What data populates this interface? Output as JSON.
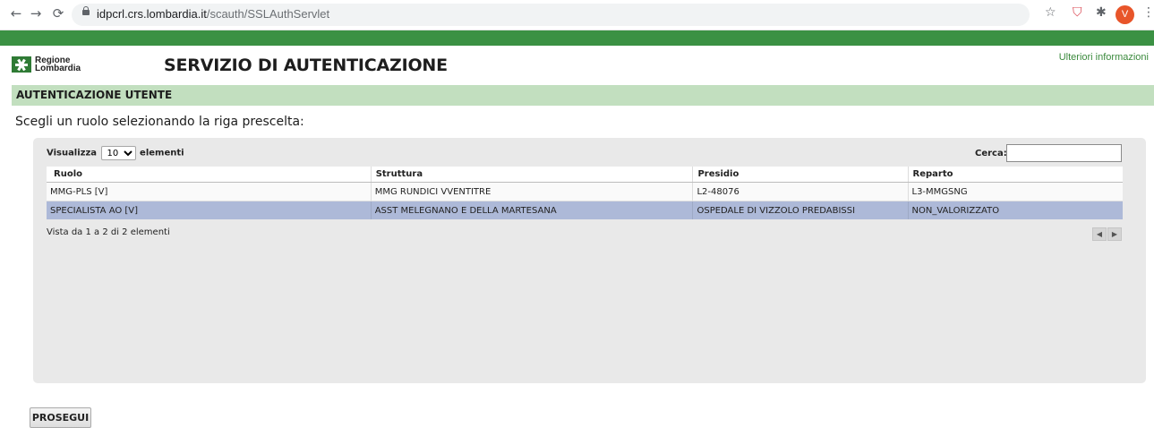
{
  "browser": {
    "url_host": "idpcrl.crs.lombardia.it",
    "url_path": "/scauth/SSLAuthServlet",
    "profile_initial": "V"
  },
  "header": {
    "logo_line1": "Regione",
    "logo_line2": "Lombardia",
    "service_title": "SERVIZIO DI AUTENTICAZIONE",
    "more_info": "Ulteriori informazioni"
  },
  "section": {
    "title": "AUTENTICAZIONE UTENTE"
  },
  "instruction": "Scegli un ruolo selezionando la riga prescelta:",
  "table_controls": {
    "show_label": "Visualizza",
    "page_length": "10",
    "elements_label": "elementi",
    "search_label": "Cerca:",
    "search_value": ""
  },
  "table": {
    "columns": [
      "Ruolo",
      "Struttura",
      "Presidio",
      "Reparto"
    ],
    "rows": [
      [
        "MMG-PLS [V]",
        "MMG RUNDICI VVENTITRE",
        "L2-48076",
        "L3-MMGSNG"
      ],
      [
        "SPECIALISTA AO [V]",
        "ASST MELEGNANO E DELLA MARTESANA",
        "OSPEDALE DI VIZZOLO PREDABISSI",
        "NON_VALORIZZATO"
      ]
    ],
    "selected_row": 1,
    "info": "Vista da 1 a 2 di 2 elementi"
  },
  "actions": {
    "proceed": "PROSEGUI"
  },
  "colors": {
    "green_bar": "#3b9143",
    "section_bg": "#c2dfbf",
    "selected_row": "#adb9d8",
    "panel_bg": "#e9e9e9"
  },
  "icons": [
    "back-arrow-icon",
    "forward-arrow-icon",
    "reload-icon",
    "lock-icon",
    "star-icon",
    "pocket-icon",
    "puzzle-icon",
    "kebab-menu-icon",
    "prev-page-icon",
    "next-page-icon"
  ]
}
